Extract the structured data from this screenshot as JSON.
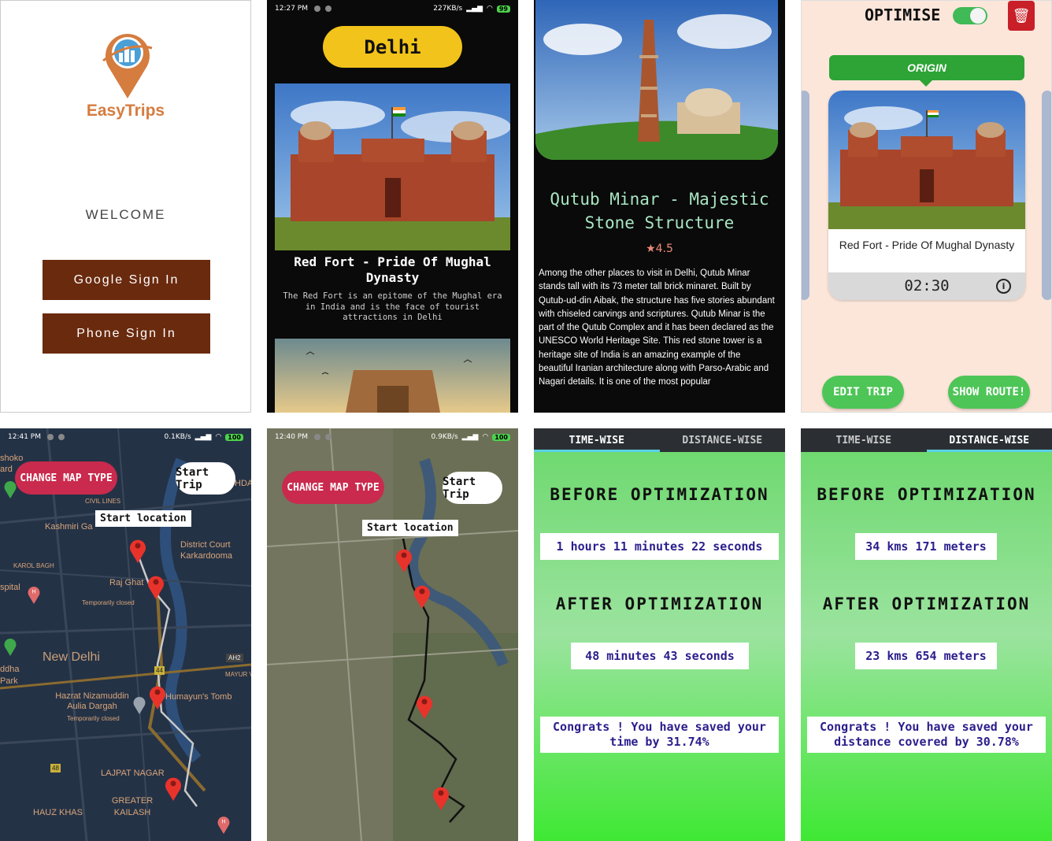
{
  "welcome": {
    "brand": "EasyTrips",
    "welcome_text": "WELCOME",
    "google_button": "Google Sign In",
    "phone_button": "Phone Sign In",
    "colors": {
      "brand": "#d57c3f",
      "button": "#6a2a0e"
    }
  },
  "city_list": {
    "status_time": "12:27 PM",
    "status_speed": "227KB/s",
    "battery": "99",
    "city": "Delhi",
    "place_title": "Red Fort - Pride Of Mughal Dynasty",
    "place_desc": "The Red Fort is an epitome of the Mughal era in India and is the face of tourist attractions in Delhi"
  },
  "detail": {
    "title": "Qutub Minar - Majestic Stone Structure",
    "rating": "4.5",
    "body": "Among the other places to visit in Delhi, Qutub Minar stands tall with its 73 meter tall brick minaret. Built by Qutub-ud-din Aibak, the structure has five stories abundant with chiseled carvings and scriptures. Qutub Minar is the part of the Qutub Complex and it has been declared as the UNESCO World Heritage Site. This red stone tower is a heritage site of India is an amazing example of the beautiful Iranian architecture along with Parso-Arabic and Nagari details. It is one of the most popular"
  },
  "optimise": {
    "label": "OPTIMISE",
    "toggle_on": true,
    "origin": "ORIGIN",
    "card_name": "Red Fort - Pride Of Mughal Dynasty",
    "card_time": "02:30",
    "edit_button": "EDIT TRIP",
    "show_button": "SHOW ROUTE!"
  },
  "map_dark": {
    "status_time": "12:41 PM",
    "status_speed": "0.1KB/s",
    "battery": "100",
    "change_map": "CHANGE MAP TYPE",
    "start_trip": "Start Trip",
    "start_location": "Start location",
    "labels": {
      "shoko": "shoko",
      "ard": "ard",
      "civil_lines": "CIVIL LINES",
      "kashmiri": "Kashmiri Ga",
      "district_court": "District Court Karkardooma",
      "karol": "KAROL BAGH",
      "spital": "spital",
      "raj_ghat": "Raj Ghat",
      "temp1": "Temporarily closed",
      "new_delhi": "New Delhi",
      "ah2": "AH2",
      "mayur": "MAYUR VI",
      "ddha": "ddha",
      "park": "Park",
      "road44": "44",
      "hazrat": "Hazrat Nizamuddin Aulia Dargah",
      "temp2": "Temporarily closed",
      "humayun": "Humayun's Tomb",
      "road48": "48",
      "lajpat": "LAJPAT NAGAR",
      "hauz": "HAUZ KHAS",
      "gk": "GREATER KAILASH",
      "hda": "HDA"
    }
  },
  "map_sat": {
    "status_time": "12:40 PM",
    "status_speed": "0.9KB/s",
    "battery": "100",
    "change_map": "CHANGE MAP TYPE",
    "start_trip": "Start Trip",
    "start_location": "Start location"
  },
  "time_stats": {
    "tab_time": "TIME-WISE",
    "tab_distance": "DISTANCE-WISE",
    "before_heading": "BEFORE OPTIMIZATION",
    "before_value": "1 hours 11 minutes 22 seconds",
    "after_heading": "AFTER OPTIMIZATION",
    "after_value": "48 minutes 43 seconds",
    "congrats": "Congrats ! You have saved your time by 31.74%"
  },
  "distance_stats": {
    "tab_time": "TIME-WISE",
    "tab_distance": "DISTANCE-WISE",
    "before_heading": "BEFORE OPTIMIZATION",
    "before_value": "34 kms 171 meters",
    "after_heading": "AFTER OPTIMIZATION",
    "after_value": "23 kms 654 meters",
    "congrats": "Congrats ! You have saved your distance covered by 30.78%"
  }
}
